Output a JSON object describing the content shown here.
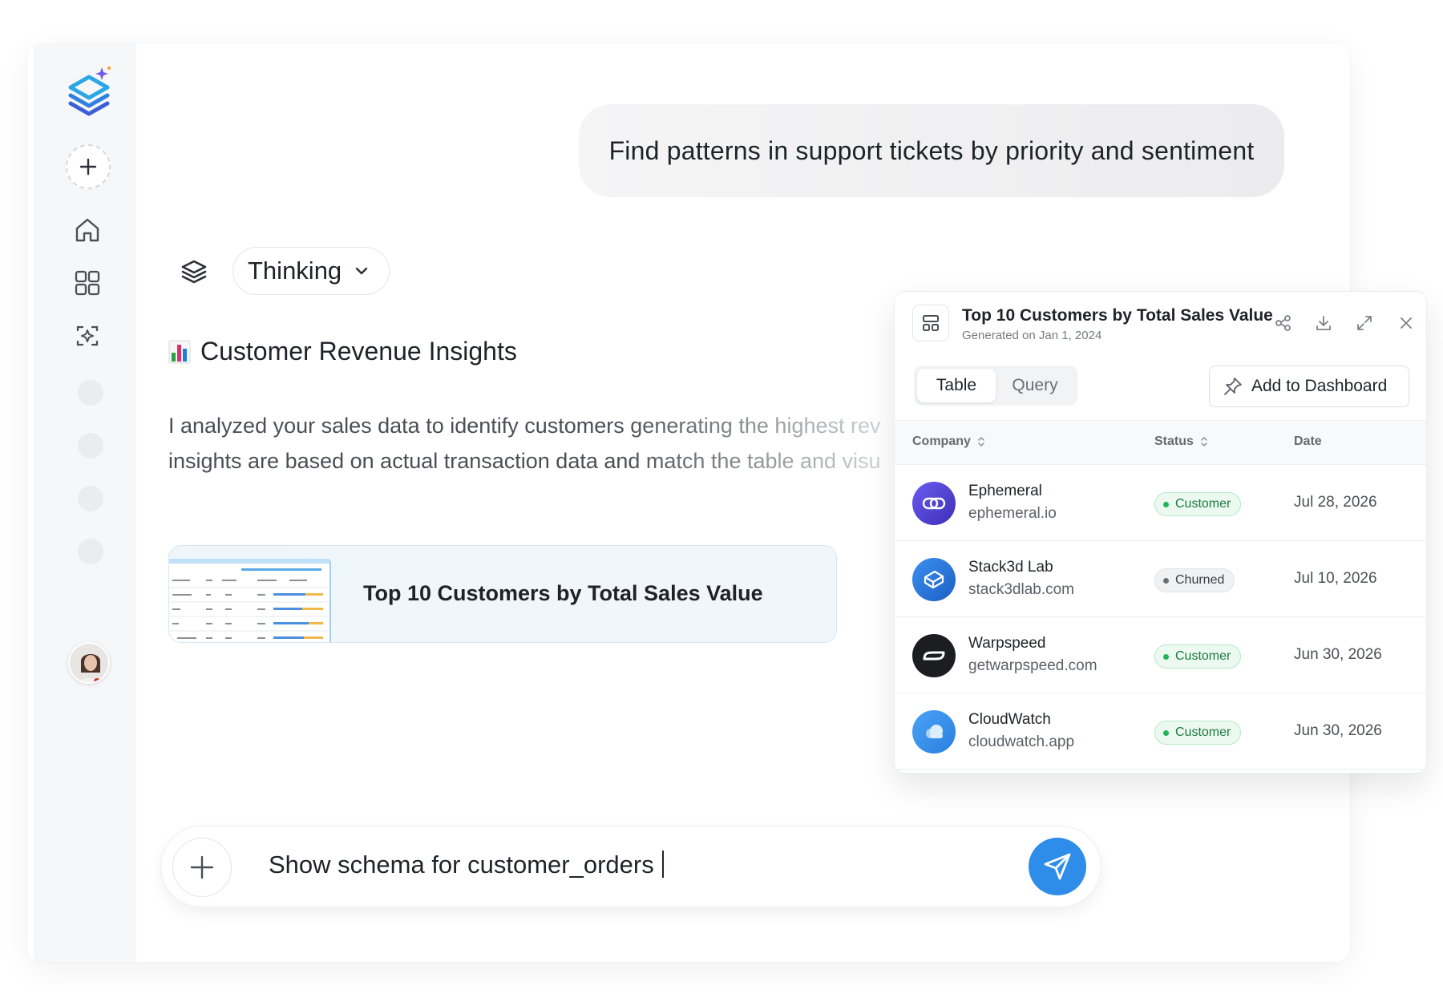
{
  "user_message": "Find patterns in support tickets by priority and sentiment",
  "thinking_label": "Thinking",
  "insights": {
    "title": "Customer Revenue Insights",
    "line1": "I analyzed your sales data to identify customers generating the highest rev",
    "line2": "insights are based on actual transaction data and match the table and visu"
  },
  "result_card": {
    "title": "Top 10 Customers by Total Sales Value"
  },
  "composer": {
    "text": "Show schema for customer_orders"
  },
  "panel": {
    "title": "Top 10 Customers by Total Sales Value",
    "subtitle": "Generated on Jan 1, 2024",
    "tabs": [
      {
        "label": "Table"
      },
      {
        "label": "Query"
      }
    ],
    "add_to_dashboard": "Add to Dashboard",
    "columns": {
      "company": "Company",
      "status": "Status",
      "date": "Date"
    },
    "rows": [
      {
        "name": "Ephemeral",
        "domain": "ephemeral.io",
        "status": "Customer",
        "date": "Jul 28, 2026"
      },
      {
        "name": "Stack3d Lab",
        "domain": "stack3dlab.com",
        "status": "Churned",
        "date": "Jul 10, 2026"
      },
      {
        "name": "Warpspeed",
        "domain": "getwarpspeed.com",
        "status": "Customer",
        "date": "Jun 30, 2026"
      },
      {
        "name": "CloudWatch",
        "domain": "cloudwatch.app",
        "status": "Customer",
        "date": "Jun 30, 2026"
      }
    ]
  },
  "colors": {
    "accent": "#2f8dea",
    "customer_badge": "#22b455",
    "churned_badge": "#6b7077"
  }
}
